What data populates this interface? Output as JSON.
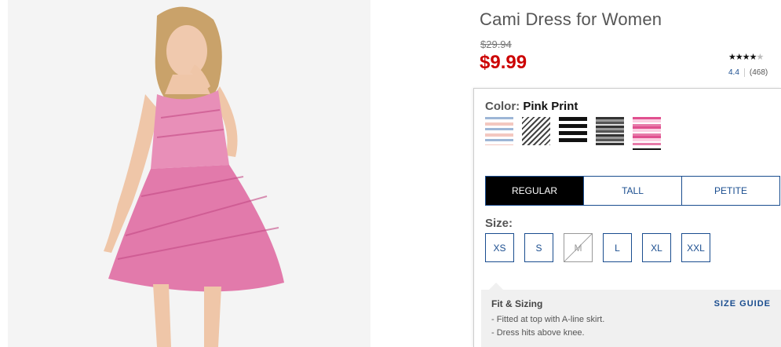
{
  "product": {
    "title": "Cami Dress for Women",
    "old_price": "$29.94",
    "price": "$9.99",
    "image_icon": "product-photo"
  },
  "rating": {
    "stars_filled": "★★★★",
    "stars_partial": "★",
    "score": "4.4",
    "count": "(468)"
  },
  "color": {
    "label": "Color:",
    "selected": "Pink Print",
    "swatches": [
      "blue-stripe",
      "black-white-diagonal",
      "black-bold-stripe",
      "grey-stripe",
      "pink-print"
    ]
  },
  "fit_tabs": [
    "REGULAR",
    "TALL",
    "PETITE"
  ],
  "size": {
    "label": "Size:",
    "options": [
      "XS",
      "S",
      "M",
      "L",
      "XL",
      "XXL"
    ]
  },
  "fit_sizing": {
    "title": "Fit & Sizing",
    "size_guide": "SIZE GUIDE",
    "bullets": [
      "- Fitted at top with A-line skirt.",
      "- Dress hits above knee."
    ]
  },
  "colors": {
    "accent": "#1a4d8f",
    "price_red": "#cc0000"
  }
}
